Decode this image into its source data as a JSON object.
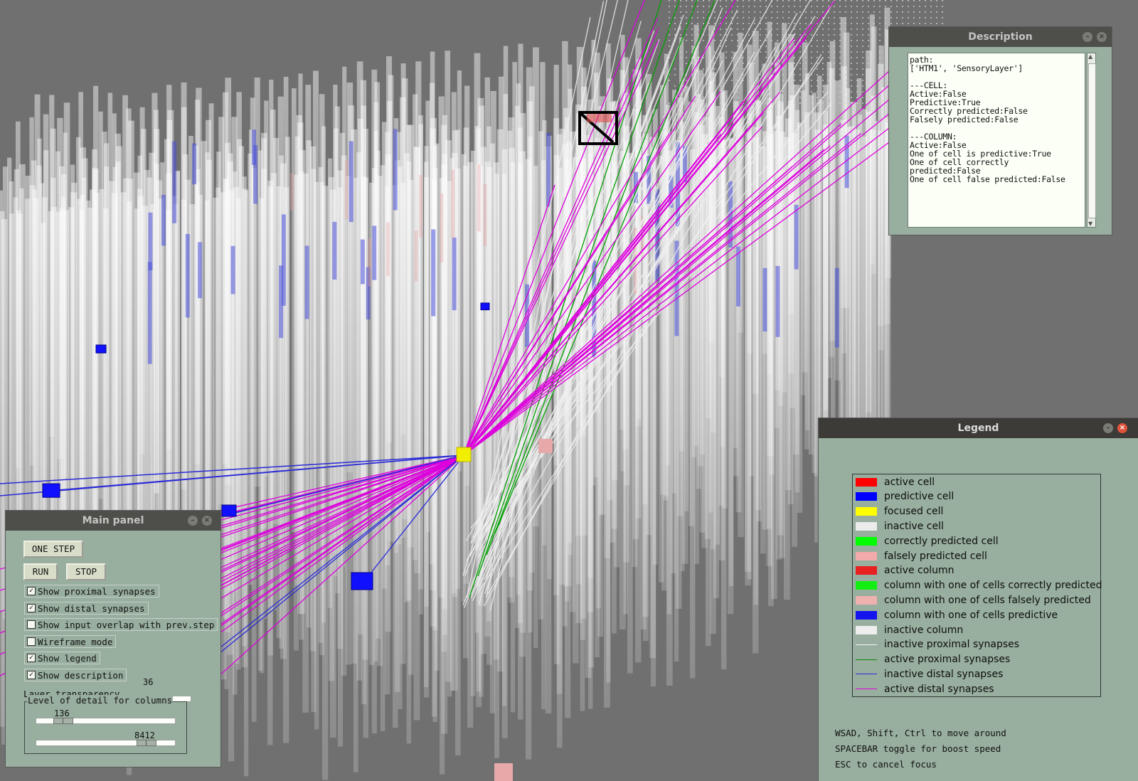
{
  "scene": {
    "focused_cell_color": "#f2ee00",
    "predictive_color": "#1010ff",
    "distal_active_color": "#dd00dd",
    "proximal_active_color": "#00a000",
    "background_color": "#707070"
  },
  "description": {
    "title": "Description",
    "text": "path:\n['HTM1', 'SensoryLayer']\n\n---CELL:\nActive:False\nPredictive:True\nCorrectly predicted:False\nFalsely predicted:False\n\n---COLUMN:\nActive:False\nOne of cell is predictive:True\nOne of cell correctly\npredicted:False\nOne of cell false predicted:False"
  },
  "legend": {
    "title": "Legend",
    "items": [
      {
        "label": "active cell",
        "color": "#ff0000",
        "kind": "swatch"
      },
      {
        "label": "predictive cell",
        "color": "#0000ff",
        "kind": "swatch"
      },
      {
        "label": "focused cell",
        "color": "#ffff00",
        "kind": "swatch"
      },
      {
        "label": "inactive cell",
        "color": "#ececec",
        "kind": "swatch"
      },
      {
        "label": "correctly predicted cell",
        "color": "#00ff00",
        "kind": "swatch"
      },
      {
        "label": "falsely predicted cell",
        "color": "#f2aaaa",
        "kind": "swatch"
      },
      {
        "label": "active column",
        "color": "#e82020",
        "kind": "swatch"
      },
      {
        "label": "column with one of cells correctly predicted",
        "color": "#12ee12",
        "kind": "swatch"
      },
      {
        "label": "column with one of cells falsely predicted",
        "color": "#efb0b0",
        "kind": "swatch"
      },
      {
        "label": "column with one of cells predictive",
        "color": "#1414ee",
        "kind": "swatch"
      },
      {
        "label": "inactive column",
        "color": "#eeeeee",
        "kind": "swatch"
      },
      {
        "label": "inactive proximal synapses",
        "color": "#f4f4f4",
        "kind": "line"
      },
      {
        "label": "active proximal synapses",
        "color": "#0a8a0a",
        "kind": "line"
      },
      {
        "label": "inactive distal synapses",
        "color": "#2a2ad8",
        "kind": "line"
      },
      {
        "label": "active distal synapses",
        "color": "#e000e0",
        "kind": "line"
      }
    ],
    "help": [
      "WSAD, Shift, Ctrl to move around",
      "SPACEBAR toggle for boost speed",
      "ESC to cancel focus"
    ]
  },
  "main_panel": {
    "title": "Main panel",
    "one_step_label": "ONE STEP",
    "run_label": "RUN",
    "stop_label": "STOP",
    "checkboxes": [
      {
        "label": "Show proximal synapses",
        "checked": true
      },
      {
        "label": "Show distal synapses",
        "checked": true
      },
      {
        "label": "Show input overlap with prev.step",
        "checked": false
      },
      {
        "label": "Wireframe mode",
        "checked": false
      },
      {
        "label": "Show legend",
        "checked": true
      },
      {
        "label": "Show description",
        "checked": true
      }
    ],
    "transparency_label": "Layer transparency",
    "transparency_value": "36",
    "lod_group_label": "Level of detail for columns",
    "lod_min_value": "136",
    "lod_max_value": "8412"
  }
}
